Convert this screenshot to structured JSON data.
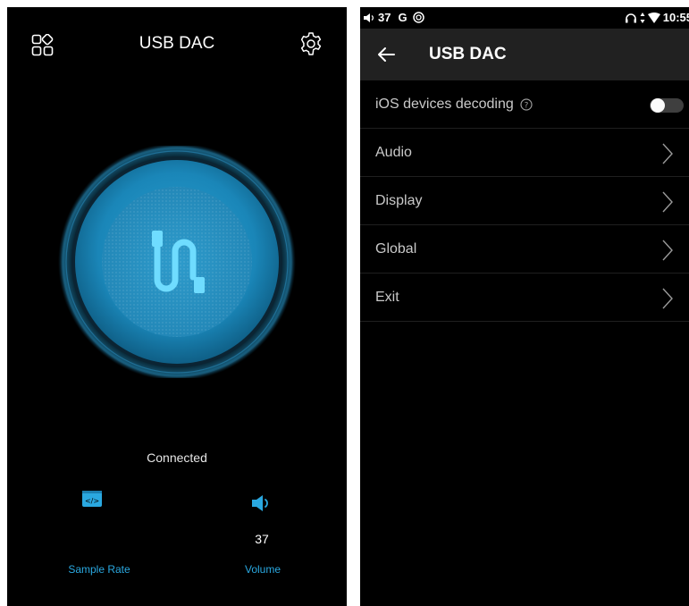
{
  "left_screen": {
    "title": "USB DAC",
    "status": "Connected",
    "sample_rate": {
      "label": "Sample Rate",
      "icon": "sample-rate-icon"
    },
    "volume": {
      "label": "Volume",
      "value": "37",
      "icon": "speaker-icon"
    },
    "icons": {
      "menu": "apps-grid-icon",
      "settings": "gear-icon",
      "center": "usb-cable-icon"
    },
    "colors": {
      "accent": "#2aa8e0",
      "dial": "#1e8fbf",
      "background": "#000000"
    }
  },
  "right_screen": {
    "status_bar": {
      "volume": "37",
      "g_label": "G",
      "time": "10:55"
    },
    "title": "USB DAC",
    "items": [
      {
        "label": "iOS devices decoding",
        "toggle": "off"
      },
      {
        "label": "Audio"
      },
      {
        "label": "Display"
      },
      {
        "label": "Global"
      },
      {
        "label": "Exit"
      }
    ],
    "colors": {
      "app_bar": "#212121",
      "background": "#000000",
      "text": "#c9c9c9"
    }
  }
}
